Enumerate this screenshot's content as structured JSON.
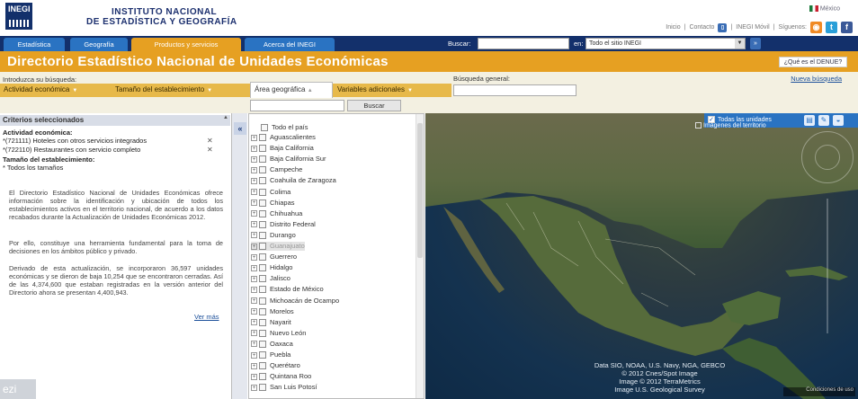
{
  "header": {
    "logo_text": "INEGI",
    "inst_line1": "INSTITUTO NACIONAL",
    "inst_line2": "DE ESTADÍSTICA Y GEOGRAFÍA",
    "country": "México",
    "top_links": [
      "Inicio",
      "Contacto",
      "INEGI Móvil",
      "Síguenos:"
    ],
    "social": [
      {
        "name": "rss",
        "glyph": "⌁",
        "color": "#f08a24"
      },
      {
        "name": "twitter",
        "glyph": "t",
        "color": "#2a9fd8"
      },
      {
        "name": "facebook",
        "glyph": "f",
        "color": "#3b5998"
      }
    ]
  },
  "nav": {
    "tabs": [
      {
        "label": "Estadística",
        "color": "#2a73c2"
      },
      {
        "label": "Geografía",
        "color": "#2a73c2"
      },
      {
        "label": "Productos y servicios",
        "color": "#e6a022"
      },
      {
        "label": "Acerca del INEGI",
        "color": "#2a73c2"
      }
    ],
    "search_label": "Buscar:",
    "search_value": "",
    "en_label": "en:",
    "scope_value": "Todo el sitio INEGI"
  },
  "title": {
    "text": "Directorio Estadístico Nacional de Unidades Económicas",
    "denue_button": "¿Qué es el DENUE?"
  },
  "controls": {
    "intro_label": "Introduzca su búsqueda:",
    "general_label": "Búsqueda general:",
    "advanced_link": "Nueva búsqueda",
    "filters": [
      "Actividad económica",
      "Tamaño del establecimiento",
      "Área geográfica",
      "Variables adicionales"
    ],
    "search_button": "Buscar"
  },
  "criteria": {
    "heading": "Criterios seleccionados",
    "activity_heading": "Actividad económica:",
    "activities": [
      "*(721111) Hoteles con otros servicios integrados",
      "*(722110) Restaurantes con servicio completo"
    ],
    "size_heading": "Tamaño del establecimiento:",
    "size_value": "* Todos los tamaños",
    "para1": "El Directorio Estadístico Nacional de Unidades Económicas ofrece información sobre la identificación y ubicación de todos los establecimientos activos en el territorio nacional, de acuerdo a los datos recabados durante la Actualización de Unidades Económicas 2012.",
    "para2": "Por ello, constituye una herramienta fundamental para la toma de decisiones en los ámbitos público y privado.",
    "para3": "Derivado de esta actualización, se incorporaron 36,597 unidades económicas y se dieron de baja 10,254 que se encontraron cerradas. Así de las 4,374,600 que estaban registradas en la versión anterior del Directorio ahora se presentan 4,400,943.",
    "see_more": "Ver más",
    "corner": "ezi"
  },
  "states": {
    "all": "Todo el país",
    "items": [
      "Aguascalientes",
      "Baja California",
      "Baja California Sur",
      "Campeche",
      "Coahuila de Zaragoza",
      "Colima",
      "Chiapas",
      "Chihuahua",
      "Distrito Federal",
      "Durango",
      "Guanajuato",
      "Guerrero",
      "Hidalgo",
      "Jalisco",
      "Estado de México",
      "Michoacán de Ocampo",
      "Morelos",
      "Nayarit",
      "Nuevo León",
      "Oaxaca",
      "Puebla",
      "Querétaro",
      "Quintana Roo",
      "San Luis Potosí"
    ],
    "highlighted": "Guanajuato"
  },
  "map": {
    "all_units": "Todas las unidades",
    "territory_images": "Imágenes del territorio",
    "attribution": [
      "Data SIO, NOAA, U.S. Navy, NGA, GEBCO",
      "© 2012 Cnes/Spot Image",
      "Image © 2012 TerraMetrics",
      "Image U.S. Geological Survey"
    ],
    "scale": "Condiciones de uso"
  }
}
